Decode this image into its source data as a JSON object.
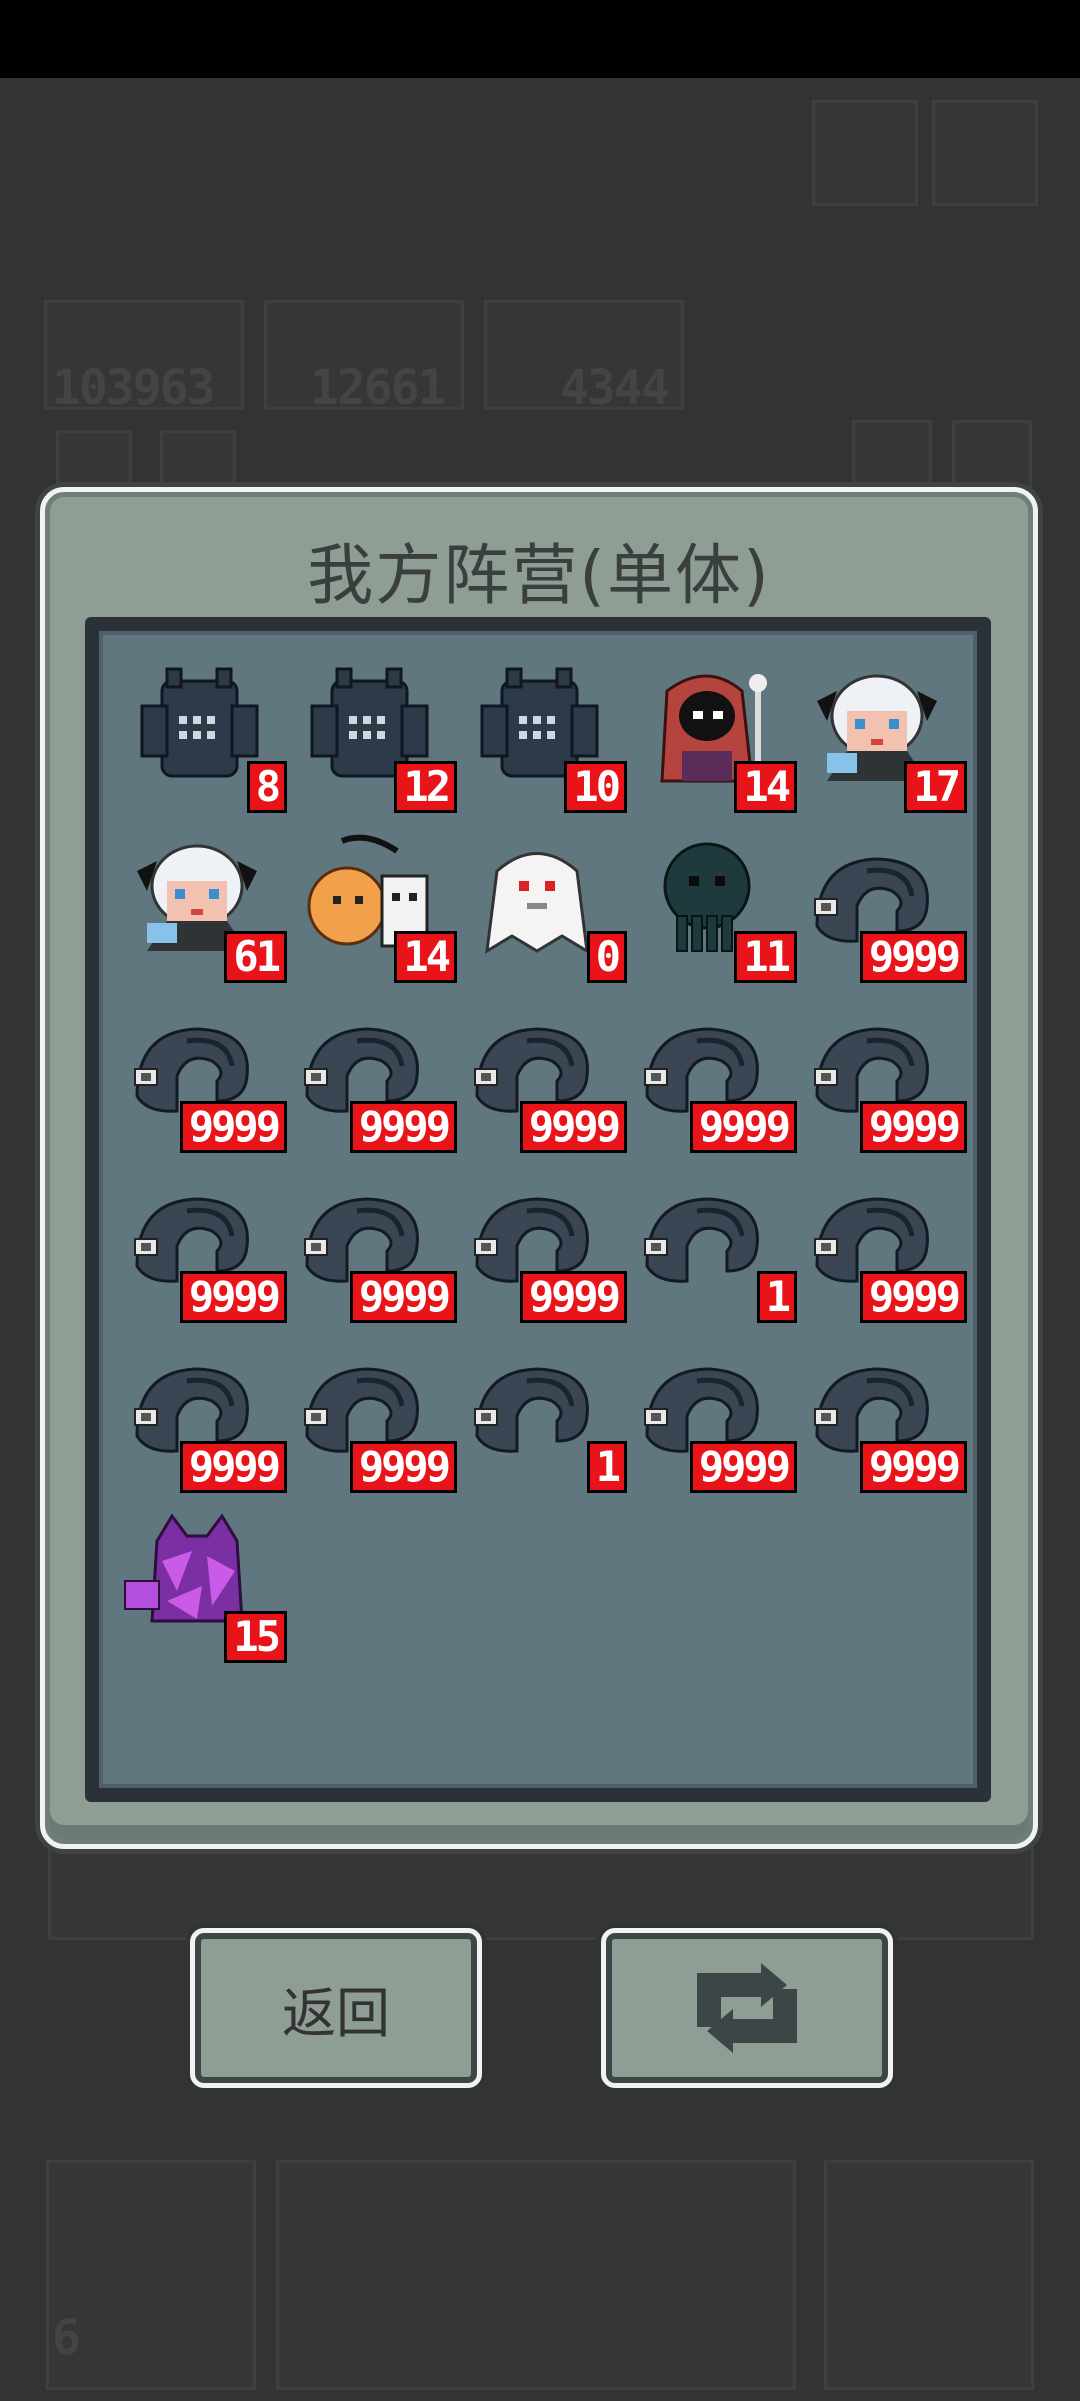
{
  "panel": {
    "title": "我方阵营(单体)"
  },
  "background": {
    "resource_values": [
      "103963",
      "12661",
      "4344"
    ],
    "badge": "6"
  },
  "units": [
    {
      "kind": "crab",
      "count": "8"
    },
    {
      "kind": "crab",
      "count": "12"
    },
    {
      "kind": "crab",
      "count": "10"
    },
    {
      "kind": "red-hooded-mage",
      "count": "14"
    },
    {
      "kind": "white-haired-girl",
      "count": "17"
    },
    {
      "kind": "white-haired-girl",
      "count": "61"
    },
    {
      "kind": "lion-and-wolf",
      "count": "14"
    },
    {
      "kind": "white-ghost",
      "count": "0"
    },
    {
      "kind": "dark-cthulhu",
      "count": "11"
    },
    {
      "kind": "gray-worm",
      "count": "9999"
    },
    {
      "kind": "gray-worm",
      "count": "9999"
    },
    {
      "kind": "gray-worm",
      "count": "9999"
    },
    {
      "kind": "gray-worm",
      "count": "9999"
    },
    {
      "kind": "gray-worm",
      "count": "9999"
    },
    {
      "kind": "gray-worm",
      "count": "9999"
    },
    {
      "kind": "gray-worm",
      "count": "9999"
    },
    {
      "kind": "gray-worm",
      "count": "9999"
    },
    {
      "kind": "gray-worm",
      "count": "9999"
    },
    {
      "kind": "gray-worm",
      "count": "1"
    },
    {
      "kind": "gray-worm",
      "count": "9999"
    },
    {
      "kind": "gray-worm",
      "count": "9999"
    },
    {
      "kind": "gray-worm",
      "count": "9999"
    },
    {
      "kind": "gray-worm",
      "count": "1"
    },
    {
      "kind": "gray-worm",
      "count": "9999"
    },
    {
      "kind": "gray-worm",
      "count": "9999"
    },
    {
      "kind": "purple-crystal-golem",
      "count": "15"
    }
  ],
  "buttons": {
    "back_label": "返回",
    "refresh_icon": "refresh-icon"
  },
  "colors": {
    "count_bg": "#e8141a",
    "panel": "#8e9e95",
    "inner": "#617780"
  }
}
